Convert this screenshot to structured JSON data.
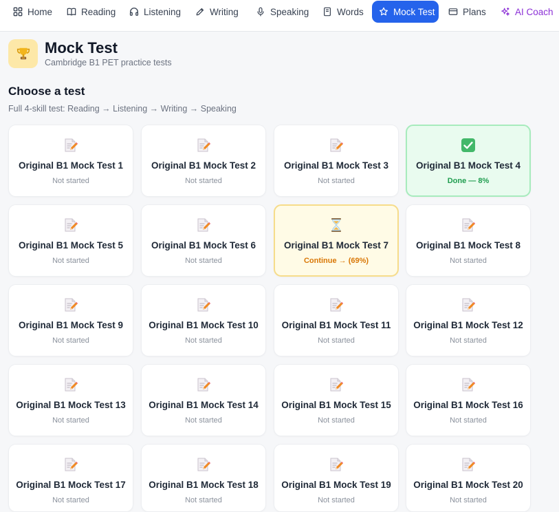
{
  "nav": {
    "items": [
      {
        "label": "Home",
        "icon": "home-grid-icon"
      },
      {
        "label": "Reading",
        "icon": "book-icon"
      },
      {
        "label": "Listening",
        "icon": "headphones-icon"
      },
      {
        "label": "Writing",
        "icon": "pen-icon"
      },
      {
        "label": "Speaking",
        "icon": "microphone-icon"
      },
      {
        "label": "Words",
        "icon": "notebook-icon"
      },
      {
        "label": "Mock Test",
        "icon": "star-icon"
      },
      {
        "label": "Plans",
        "icon": "card-icon"
      },
      {
        "label": "AI Coach",
        "icon": "sparkles-icon"
      }
    ],
    "active_color": "#2563eb",
    "coach_color": "#8b2fd6"
  },
  "header": {
    "title": "Mock Test",
    "subtitle": "Cambridge B1 PET practice tests",
    "icon": "trophy-icon"
  },
  "section": {
    "title": "Choose a test",
    "description": "Full 4-skill test: Reading → Listening → Writing → Speaking"
  },
  "tests": [
    {
      "title": "Original B1 Mock Test 1",
      "status": "Not started",
      "state": "new"
    },
    {
      "title": "Original B1 Mock Test 2",
      "status": "Not started",
      "state": "new"
    },
    {
      "title": "Original B1 Mock Test 3",
      "status": "Not started",
      "state": "new"
    },
    {
      "title": "Original B1 Mock Test 4",
      "status": "Done — 8%",
      "state": "done"
    },
    {
      "title": "Original B1 Mock Test 5",
      "status": "Not started",
      "state": "new"
    },
    {
      "title": "Original B1 Mock Test 6",
      "status": "Not started",
      "state": "new"
    },
    {
      "title": "Original B1 Mock Test 7",
      "status": "Continue → (69%)",
      "state": "progress"
    },
    {
      "title": "Original B1 Mock Test 8",
      "status": "Not started",
      "state": "new"
    },
    {
      "title": "Original B1 Mock Test 9",
      "status": "Not started",
      "state": "new"
    },
    {
      "title": "Original B1 Mock Test 10",
      "status": "Not started",
      "state": "new"
    },
    {
      "title": "Original B1 Mock Test 11",
      "status": "Not started",
      "state": "new"
    },
    {
      "title": "Original B1 Mock Test 12",
      "status": "Not started",
      "state": "new"
    },
    {
      "title": "Original B1 Mock Test 13",
      "status": "Not started",
      "state": "new"
    },
    {
      "title": "Original B1 Mock Test 14",
      "status": "Not started",
      "state": "new"
    },
    {
      "title": "Original B1 Mock Test 15",
      "status": "Not started",
      "state": "new"
    },
    {
      "title": "Original B1 Mock Test 16",
      "status": "Not started",
      "state": "new"
    },
    {
      "title": "Original B1 Mock Test 17",
      "status": "Not started",
      "state": "new"
    },
    {
      "title": "Original B1 Mock Test 18",
      "status": "Not started",
      "state": "new"
    },
    {
      "title": "Original B1 Mock Test 19",
      "status": "Not started",
      "state": "new"
    },
    {
      "title": "Original B1 Mock Test 20",
      "status": "Not started",
      "state": "new"
    }
  ],
  "colors": {
    "done": "#1f9d4f",
    "progress": "#d97706",
    "muted": "#8a919c"
  }
}
